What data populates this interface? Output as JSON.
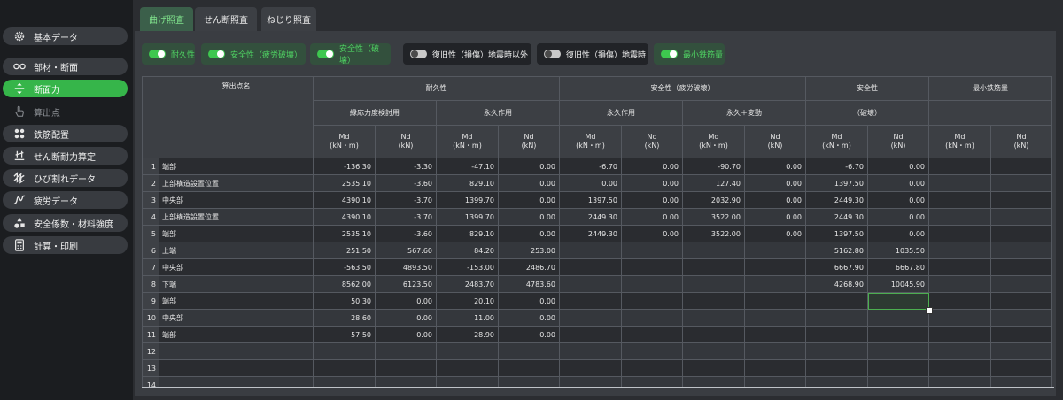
{
  "sidebar": {
    "items": [
      {
        "label": "基本データ",
        "icon": "gear-icon",
        "state": "normal"
      },
      {
        "label": "部材・断面",
        "icon": "link-icon",
        "state": "normal"
      },
      {
        "label": "断面力",
        "icon": "split-arrows-icon",
        "state": "active"
      },
      {
        "label": "算出点",
        "icon": "hand-pointer-icon",
        "state": "disabled"
      },
      {
        "label": "鉄筋配置",
        "icon": "rebar-dots-icon",
        "state": "normal"
      },
      {
        "label": "せん断耐力算定",
        "icon": "shear-icon",
        "state": "normal"
      },
      {
        "label": "ひび割れデータ",
        "icon": "zigzag-icon",
        "state": "normal"
      },
      {
        "label": "疲労データ",
        "icon": "wave-icon",
        "state": "normal"
      },
      {
        "label": "安全係数・材料強度",
        "icon": "shapes-icon",
        "state": "normal"
      },
      {
        "label": "計算・印刷",
        "icon": "calculator-icon",
        "state": "normal"
      }
    ]
  },
  "tabs": [
    {
      "label": "曲げ照査",
      "active": true
    },
    {
      "label": "せん断照査",
      "active": false
    },
    {
      "label": "ねじり照査",
      "active": false
    }
  ],
  "toggles": [
    {
      "label": "耐久性",
      "on": true
    },
    {
      "label": "安全性（疲労破壊）",
      "on": true
    },
    {
      "label": "安全性（破壊）",
      "on": true
    },
    {
      "label": "復旧性（損傷）地震時以外",
      "on": false
    },
    {
      "label": "復旧性（損傷）地震時",
      "on": false
    },
    {
      "label": "最小鉄筋量",
      "on": true
    }
  ],
  "colors": {
    "accent": "#36b54a",
    "toggle_on_text": "#4fd162",
    "background": "#2b2d31"
  },
  "grid": {
    "header": {
      "point_name": "算出点名",
      "groups": [
        "耐久性",
        "安全性（疲労破壊）",
        "安全性",
        "最小鉄筋量"
      ],
      "subgroups": [
        "縁応力度検討用",
        "永久作用",
        "永久作用",
        "永久＋変動",
        "（破壊）"
      ],
      "md": "Md",
      "md_unit": "(kN・m)",
      "nd": "Nd",
      "nd_unit": "(kN)"
    },
    "rows": [
      {
        "no": "1",
        "name": "端部",
        "v": [
          "-136.30",
          "-3.30",
          "-47.10",
          "0.00",
          "-6.70",
          "0.00",
          "-90.70",
          "0.00",
          "-6.70",
          "0.00",
          "",
          ""
        ]
      },
      {
        "no": "2",
        "name": "上部構造設置位置",
        "v": [
          "2535.10",
          "-3.60",
          "829.10",
          "0.00",
          "0.00",
          "0.00",
          "127.40",
          "0.00",
          "1397.50",
          "0.00",
          "",
          ""
        ]
      },
      {
        "no": "3",
        "name": "中央部",
        "v": [
          "4390.10",
          "-3.70",
          "1399.70",
          "0.00",
          "1397.50",
          "0.00",
          "2032.90",
          "0.00",
          "2449.30",
          "0.00",
          "",
          ""
        ]
      },
      {
        "no": "4",
        "name": "上部構造設置位置",
        "v": [
          "4390.10",
          "-3.70",
          "1399.70",
          "0.00",
          "2449.30",
          "0.00",
          "3522.00",
          "0.00",
          "2449.30",
          "0.00",
          "",
          ""
        ]
      },
      {
        "no": "5",
        "name": "端部",
        "v": [
          "2535.10",
          "-3.60",
          "829.10",
          "0.00",
          "2449.30",
          "0.00",
          "3522.00",
          "0.00",
          "1397.50",
          "0.00",
          "",
          ""
        ]
      },
      {
        "no": "6",
        "name": "上端",
        "v": [
          "251.50",
          "567.60",
          "84.20",
          "253.00",
          "",
          "",
          "",
          "",
          "5162.80",
          "1035.50",
          "",
          ""
        ]
      },
      {
        "no": "7",
        "name": "中央部",
        "v": [
          "-563.50",
          "4893.50",
          "-153.00",
          "2486.70",
          "",
          "",
          "",
          "",
          "6667.90",
          "6667.80",
          "",
          ""
        ]
      },
      {
        "no": "8",
        "name": "下端",
        "v": [
          "8562.00",
          "6123.50",
          "2483.70",
          "4783.60",
          "",
          "",
          "",
          "",
          "4268.90",
          "10045.90",
          "",
          ""
        ]
      },
      {
        "no": "9",
        "name": "端部",
        "v": [
          "50.30",
          "0.00",
          "20.10",
          "0.00",
          "",
          "",
          "",
          "",
          "",
          "",
          "",
          ""
        ]
      },
      {
        "no": "10",
        "name": "中央部",
        "v": [
          "28.60",
          "0.00",
          "11.00",
          "0.00",
          "",
          "",
          "",
          "",
          "",
          "",
          "",
          ""
        ]
      },
      {
        "no": "11",
        "name": "端部",
        "v": [
          "57.50",
          "0.00",
          "28.90",
          "0.00",
          "",
          "",
          "",
          "",
          "",
          "",
          "",
          ""
        ]
      },
      {
        "no": "12",
        "name": "",
        "v": [
          "",
          "",
          "",
          "",
          "",
          "",
          "",
          "",
          "",
          "",
          "",
          ""
        ]
      },
      {
        "no": "13",
        "name": "",
        "v": [
          "",
          "",
          "",
          "",
          "",
          "",
          "",
          "",
          "",
          "",
          "",
          ""
        ]
      },
      {
        "no": "14",
        "name": "",
        "v": [
          "",
          "",
          "",
          "",
          "",
          "",
          "",
          "",
          "",
          "",
          "",
          ""
        ]
      }
    ]
  }
}
